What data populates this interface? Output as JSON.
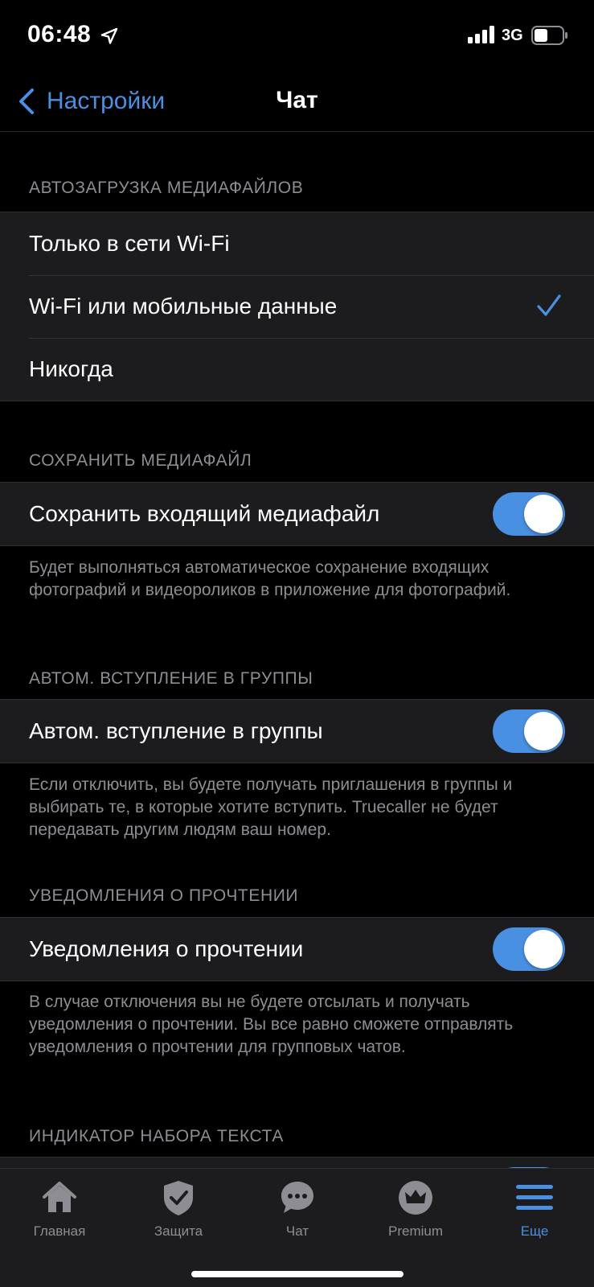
{
  "status_bar": {
    "time": "06:48",
    "network": "3G",
    "icons": [
      "location-arrow-icon",
      "signal-bars-icon",
      "battery-icon"
    ]
  },
  "nav": {
    "back_label": "Настройки",
    "title": "Чат"
  },
  "sections": {
    "autodownload": {
      "header": "АВТОЗАГРУЗКА МЕДИАФАЙЛОВ",
      "options": [
        "Только в сети Wi-Fi",
        "Wi-Fi или мобильные данные",
        "Никогда"
      ],
      "selected": "Wi-Fi или мобильные данные"
    },
    "save_media": {
      "header": "СОХРАНИТЬ МЕДИАФАЙЛ",
      "label": "Сохранить входящий медиафайл",
      "enabled": true,
      "footer": "Будет выполняться автоматическое сохранение входящих фотографий и видеороликов в приложение для фотографий."
    },
    "auto_join": {
      "header": "АВТОМ. ВСТУПЛЕНИЕ В ГРУППЫ",
      "label": "Автом. вступление в группы",
      "enabled": true,
      "footer": "Если отключить, вы будете получать приглашения в группы и выбирать те, в которые хотите вступить. Truecaller не будет передавать другим людям ваш номер."
    },
    "read_receipts": {
      "header": "УВЕДОМЛЕНИЯ О ПРОЧТЕНИИ",
      "label": "Уведомления о прочтении",
      "enabled": true,
      "footer": "В случае отключения вы не будете отсылать и получать уведомления о прочтении. Вы все равно сможете отправлять уведомления о прочтении для групповых чатов."
    },
    "typing_indicator": {
      "header": "ИНДИКАТОР НАБОРА ТЕКСТА"
    }
  },
  "tab_bar": {
    "tabs": [
      {
        "label": "Главная",
        "icon": "home-icon",
        "active": false
      },
      {
        "label": "Защита",
        "icon": "shield-check-icon",
        "active": false
      },
      {
        "label": "Чат",
        "icon": "chat-bubble-icon",
        "active": false
      },
      {
        "label": "Premium",
        "icon": "crown-icon",
        "active": false
      },
      {
        "label": "Еще",
        "icon": "menu-lines-icon",
        "active": true
      }
    ]
  },
  "colors": {
    "accent": "#4a90e2",
    "background": "#000000",
    "cell": "#1c1c1e",
    "secondary_text": "#8d8d93"
  }
}
